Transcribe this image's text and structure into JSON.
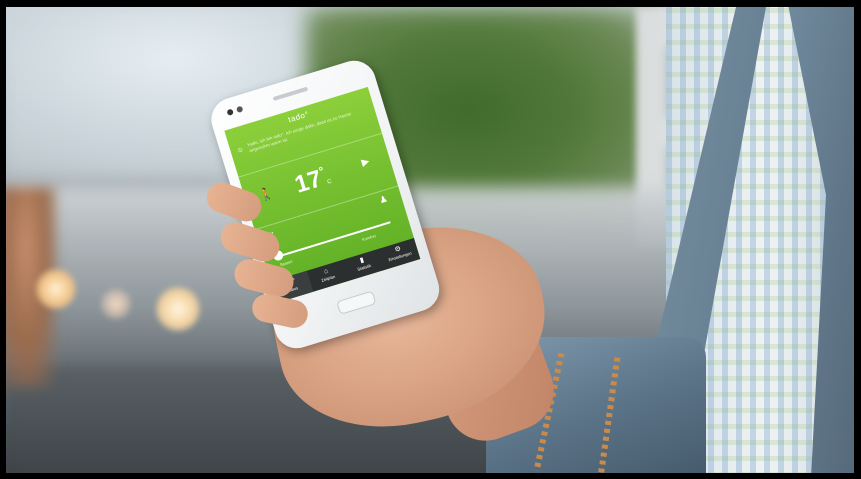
{
  "screen": {
    "brand": "tado°",
    "message": "Hallo, ich bin tado°. Ich sorge dafür, dass es zu Hause angenehm warm ist.",
    "temperature": "17",
    "temperature_unit": "°",
    "temperature_suffix": "C",
    "slider_left_label": "Sparen",
    "slider_right_label": "Komfort",
    "nav": [
      {
        "label": "Status",
        "glyph": "17°"
      },
      {
        "label": "Zeitplan",
        "glyph": "⌂"
      },
      {
        "label": "Statistik",
        "glyph": "▮"
      },
      {
        "label": "Einstellungen",
        "glyph": "⚙"
      }
    ]
  },
  "colors": {
    "screen_green": "#74bf2f",
    "navbar": "#2c2f2f"
  }
}
